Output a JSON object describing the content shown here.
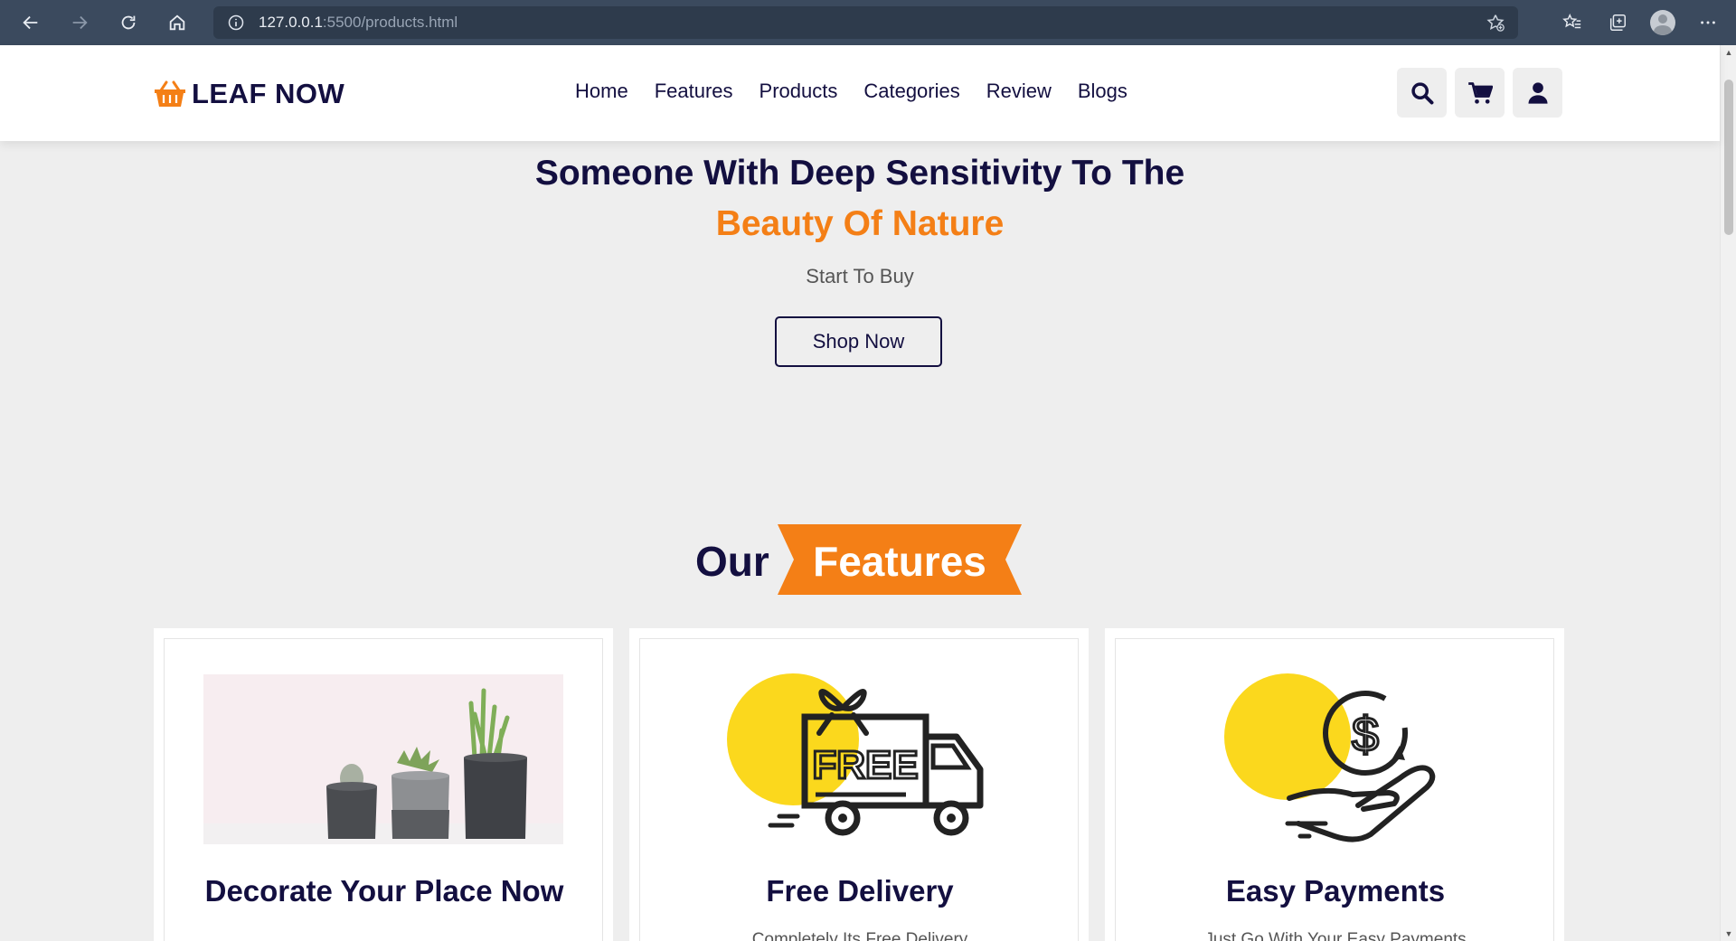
{
  "browser": {
    "url_host": "127.0.0.1",
    "url_path": ":5500/products.html"
  },
  "header": {
    "logo_text": "LEAF NOW",
    "nav": [
      "Home",
      "Features",
      "Products",
      "Categories",
      "Review",
      "Blogs"
    ]
  },
  "hero": {
    "title": "Someone With Deep Sensitivity To The",
    "accent": "Beauty Of Nature",
    "subtitle": "Start To Buy",
    "button": "Shop Now"
  },
  "features": {
    "heading_plain": "Our",
    "heading_tag": "Features",
    "cards": [
      {
        "title": "Decorate Your Place Now",
        "desc": ""
      },
      {
        "title": "Free Delivery",
        "desc": "Completely Its Free Delivery"
      },
      {
        "title": "Easy Payments",
        "desc": "Just Go With Your Easy Payments"
      }
    ]
  },
  "colors": {
    "primary": "#130f40",
    "accent": "#f47f16",
    "background": "#eeeeee",
    "yellow": "#fbd81d"
  }
}
